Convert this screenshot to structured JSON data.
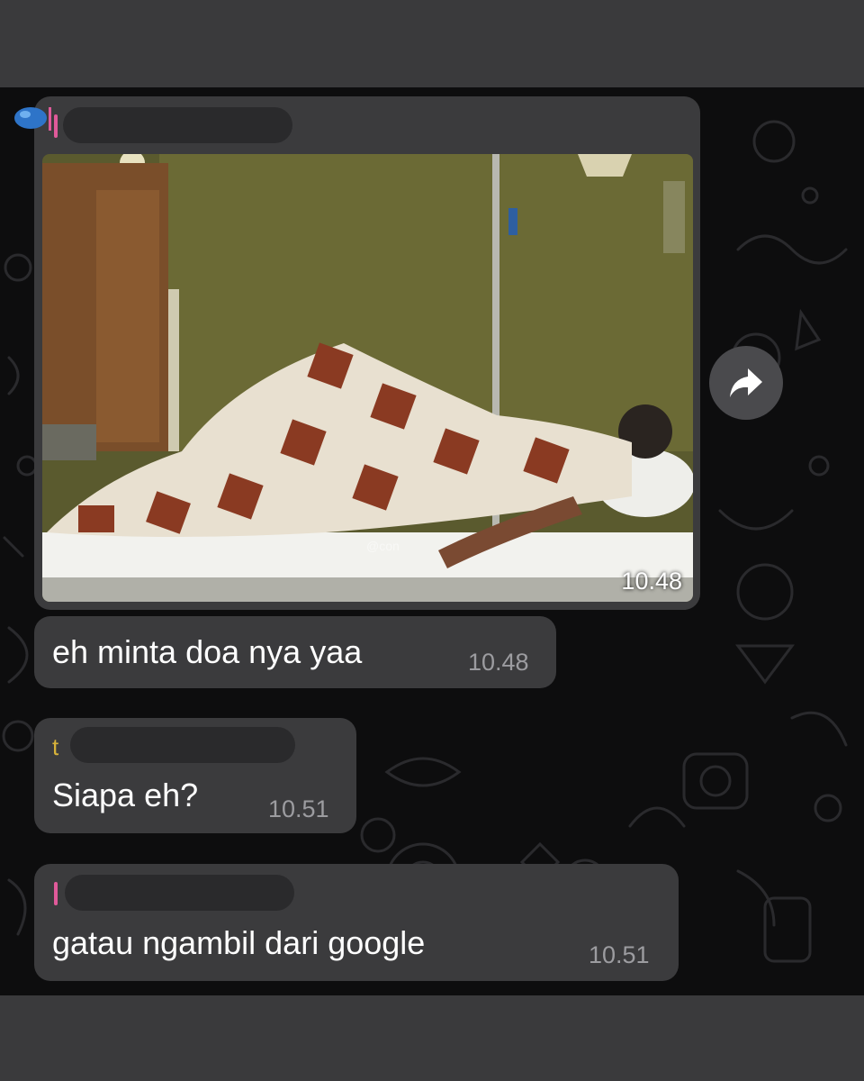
{
  "messages": [
    {
      "type": "image",
      "time": "10.48"
    },
    {
      "type": "text",
      "text": "eh minta doa nya yaa",
      "time": "10.48"
    },
    {
      "type": "text",
      "text": "Siapa eh?",
      "time": "10.51",
      "sender_initial": "t"
    },
    {
      "type": "text",
      "text": "gatau ngambil dari google",
      "time": "10.51"
    }
  ],
  "forward_icon": "forward-arrow-icon",
  "colors": {
    "background": "#0d0d0e",
    "bubble": "#3b3b3d",
    "time": "#9c9ca0",
    "accent_pink": "#e05a9a",
    "accent_yellow": "#d6b23a"
  }
}
